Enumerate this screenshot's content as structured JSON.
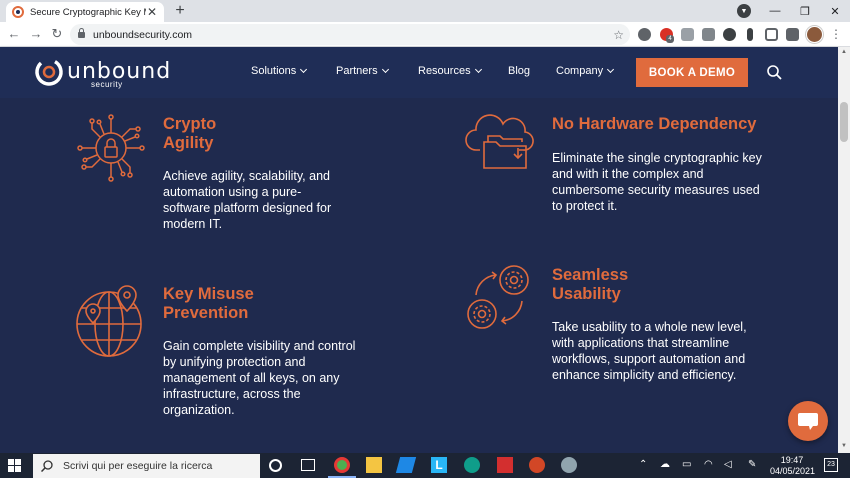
{
  "browser": {
    "tab_title": "Secure Cryptographic Key Manag",
    "new_tab_symbol": "+",
    "close_symbol": "✕",
    "url": "unboundsecurity.com",
    "window_controls": {
      "minimize": "—",
      "restore": "❐",
      "close": "✕"
    },
    "extension_badge": "4"
  },
  "site": {
    "logo_text": "unbound",
    "logo_sub": "security",
    "nav": [
      {
        "label": "Solutions",
        "has_dropdown": true
      },
      {
        "label": "Partners",
        "has_dropdown": true
      },
      {
        "label": "Resources",
        "has_dropdown": true
      },
      {
        "label": "Blog",
        "has_dropdown": false
      },
      {
        "label": "Company",
        "has_dropdown": true
      }
    ],
    "cta": "BOOK A DEMO",
    "accent_color": "#e06b3d",
    "background_color": "#1f2a4e"
  },
  "features": [
    {
      "title_line1": "Crypto",
      "title_line2": "Agility",
      "text": "Achieve agility, scalability, and automation using a pure-software platform designed for modern IT.",
      "icon": "circuit-lock-icon"
    },
    {
      "title_line1": "No Hardware Dependency",
      "title_line2": "",
      "text": "Eliminate the single cryptographic key and with it the complex and cumbersome security measures used to protect it.",
      "icon": "cloud-folder-icon"
    },
    {
      "title_line1": "Key Misuse",
      "title_line2": "Prevention",
      "text": "Gain complete visibility and control by unifying protection and management of all keys, on any infrastructure, across the organization.",
      "icon": "globe-location-icon"
    },
    {
      "title_line1": "Seamless",
      "title_line2": "Usability",
      "text": "Take usability to a whole new level, with applications that streamline workflows, support automation and enhance simplicity and efficiency.",
      "icon": "gears-cycle-icon"
    }
  ],
  "taskbar": {
    "search_placeholder": "Scrivi qui per eseguire la ricerca",
    "time": "19:47",
    "date": "04/05/2021",
    "notifications": "23"
  }
}
